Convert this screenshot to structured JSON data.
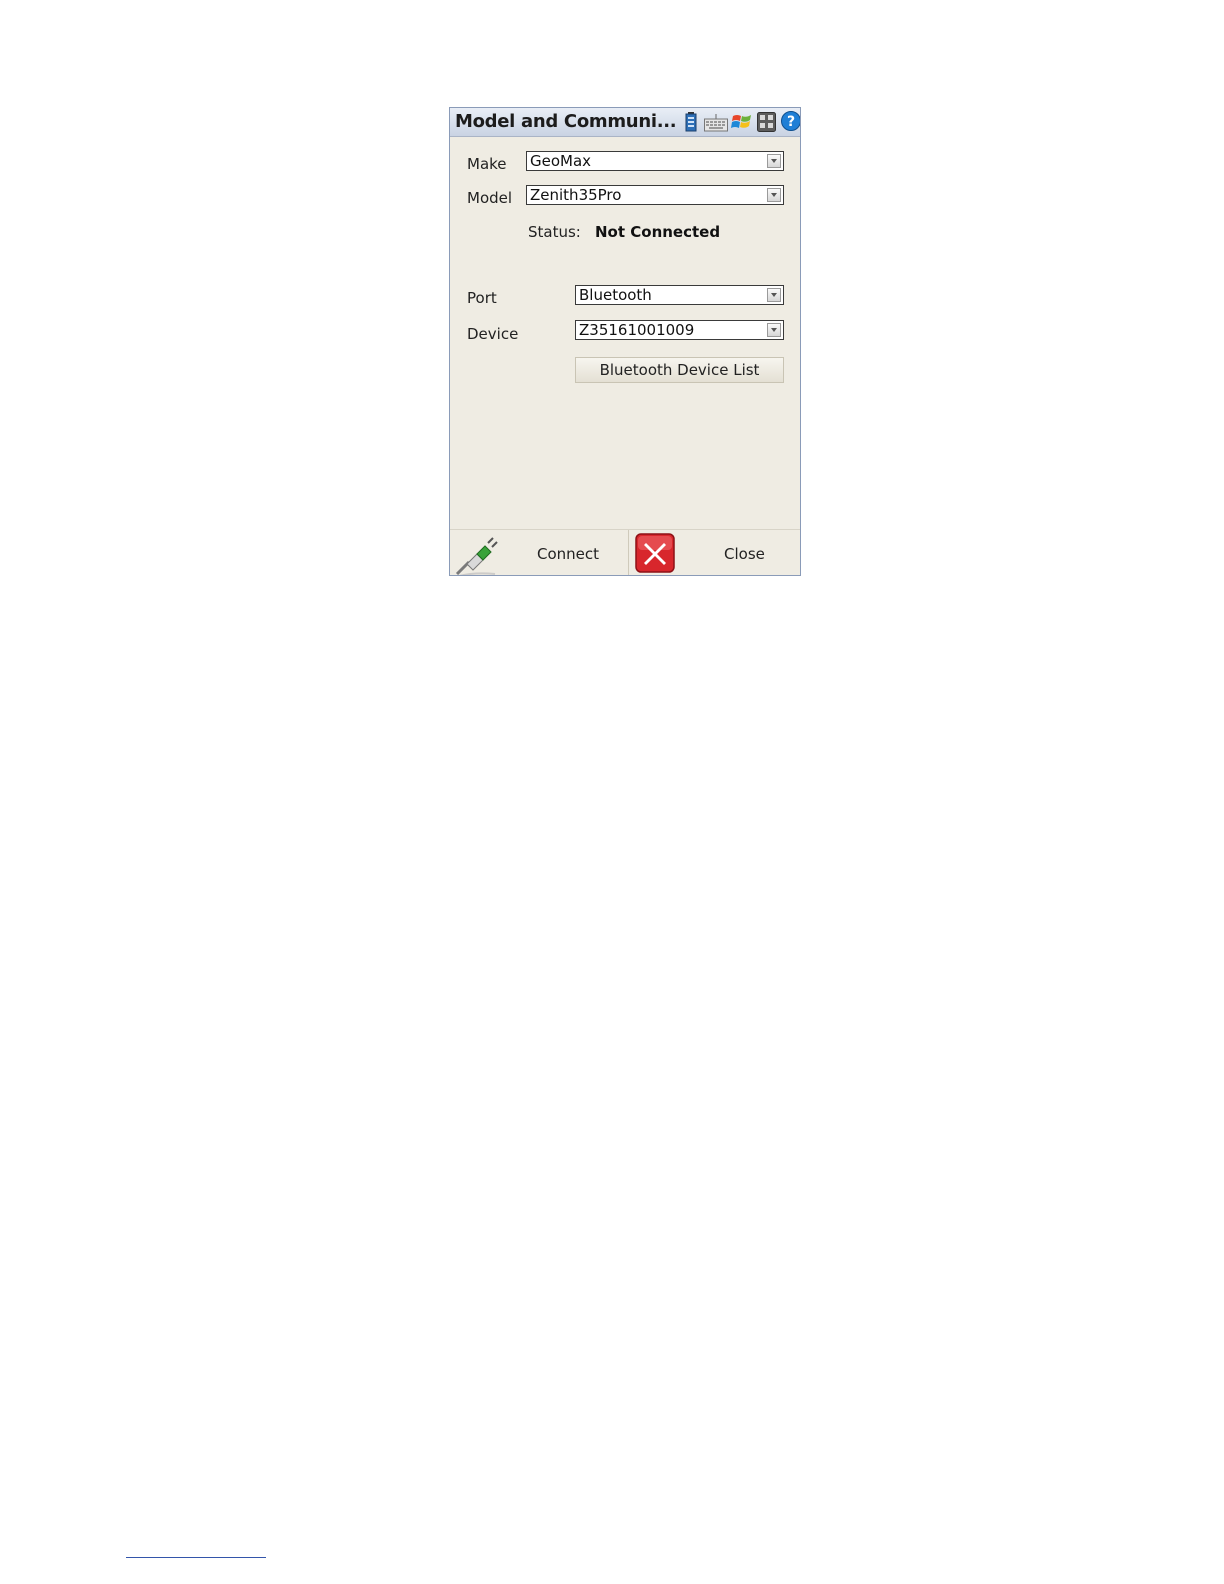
{
  "window": {
    "title": "Model and Communi...",
    "icons": [
      "battery-icon",
      "keyboard-icon",
      "windows-start-icon",
      "calculator-icon",
      "help-icon"
    ]
  },
  "form": {
    "make_label": "Make",
    "make_value": "GeoMax",
    "model_label": "Model",
    "model_value": "Zenith35Pro",
    "status_label": "Status:",
    "status_value": "Not Connected",
    "port_label": "Port",
    "port_value": "Bluetooth",
    "device_label": "Device",
    "device_value": "Z35161001009",
    "bluetooth_button": "Bluetooth Device List"
  },
  "bottom": {
    "connect_label": "Connect",
    "close_label": "Close"
  },
  "colors": {
    "background": "#efece3",
    "titlebar": "#c9d3e3",
    "close_red": "#d8262c",
    "plug_green": "#3aa33a"
  }
}
